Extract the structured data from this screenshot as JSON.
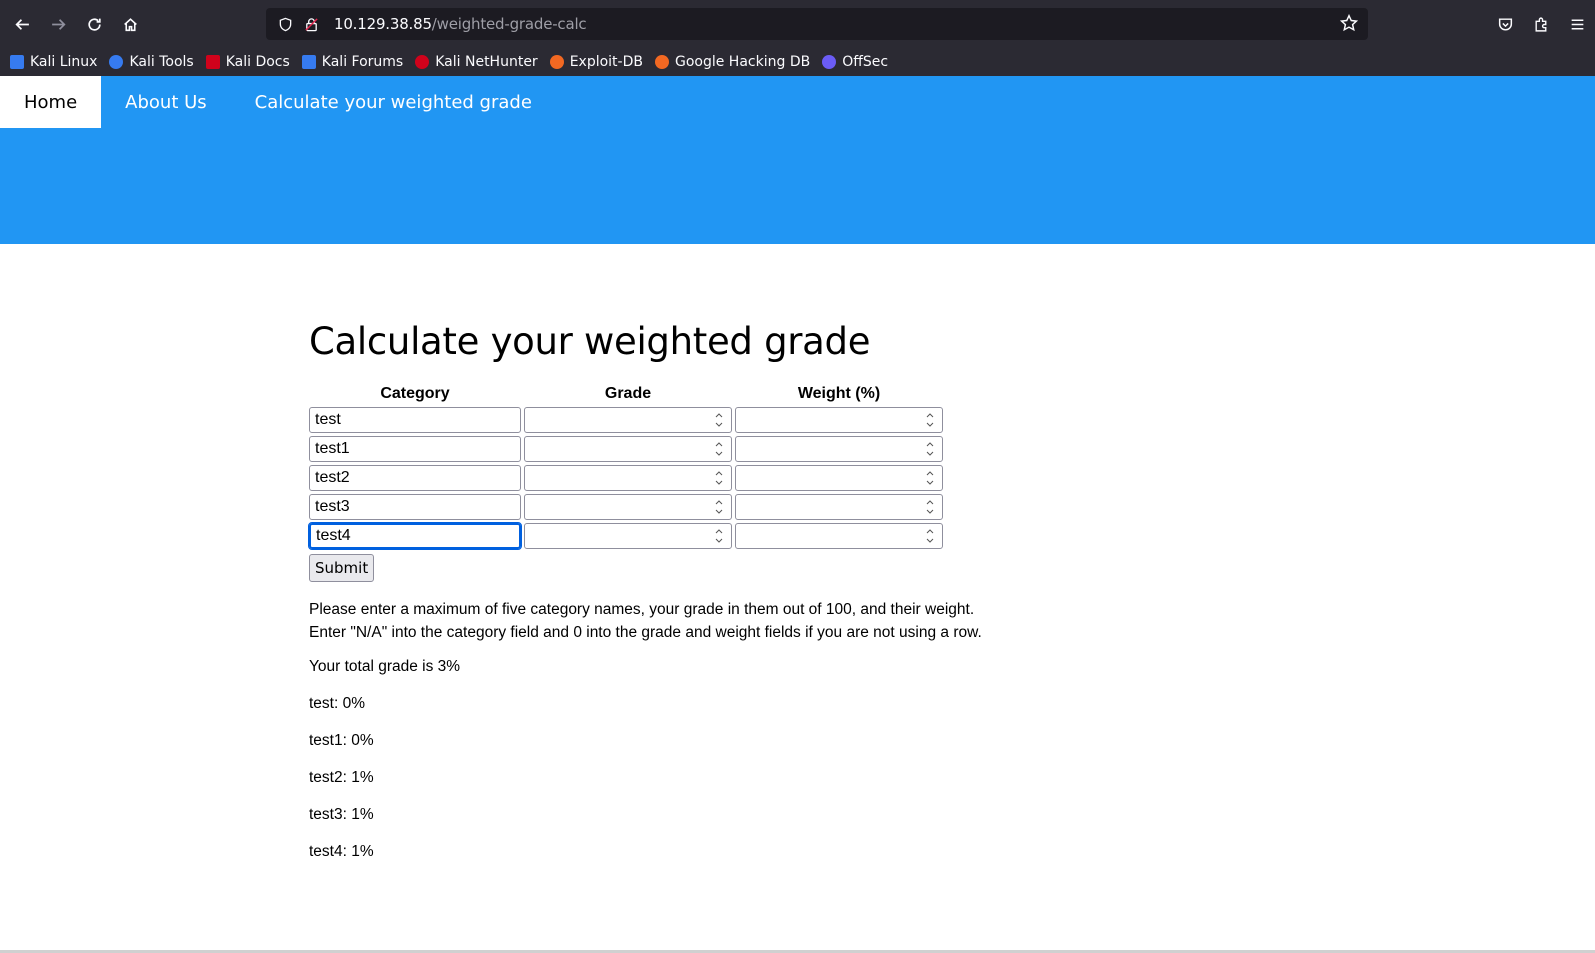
{
  "browser": {
    "url_host": "10.129.38.85",
    "url_path": "/weighted-grade-calc",
    "bookmarks": [
      {
        "label": "Kali Linux",
        "color": "#367bf0"
      },
      {
        "label": "Kali Tools",
        "color": "#367bf0"
      },
      {
        "label": "Kali Docs",
        "color": "#d0021b"
      },
      {
        "label": "Kali Forums",
        "color": "#367bf0"
      },
      {
        "label": "Kali NetHunter",
        "color": "#d0021b"
      },
      {
        "label": "Exploit-DB",
        "color": "#f26822"
      },
      {
        "label": "Google Hacking DB",
        "color": "#f26822"
      },
      {
        "label": "OffSec",
        "color": "#6b5cf6"
      }
    ]
  },
  "nav": {
    "home": "Home",
    "about": "About Us",
    "calc": "Calculate your weighted grade"
  },
  "colors": {
    "brand": "#2196f3",
    "focus": "#0060df"
  },
  "form": {
    "title": "Calculate your weighted grade",
    "headers": {
      "category": "Category",
      "grade": "Grade",
      "weight": "Weight (%)"
    },
    "rows": [
      {
        "category": "test",
        "grade": "",
        "weight": ""
      },
      {
        "category": "test1",
        "grade": "",
        "weight": ""
      },
      {
        "category": "test2",
        "grade": "",
        "weight": ""
      },
      {
        "category": "test3",
        "grade": "",
        "weight": ""
      },
      {
        "category": "test4",
        "grade": "",
        "weight": ""
      }
    ],
    "submit_label": "Submit"
  },
  "help": {
    "line1": "Please enter a maximum of five category names, your grade in them out of 100, and their weight.",
    "line2": "Enter \"N/A\" into the category field and 0 into the grade and weight fields if you are not using a row."
  },
  "results": {
    "total": "Your total grade is 3%",
    "items": [
      "test: 0%",
      "test1: 0%",
      "test2: 1%",
      "test3: 1%",
      "test4: 1%"
    ]
  }
}
